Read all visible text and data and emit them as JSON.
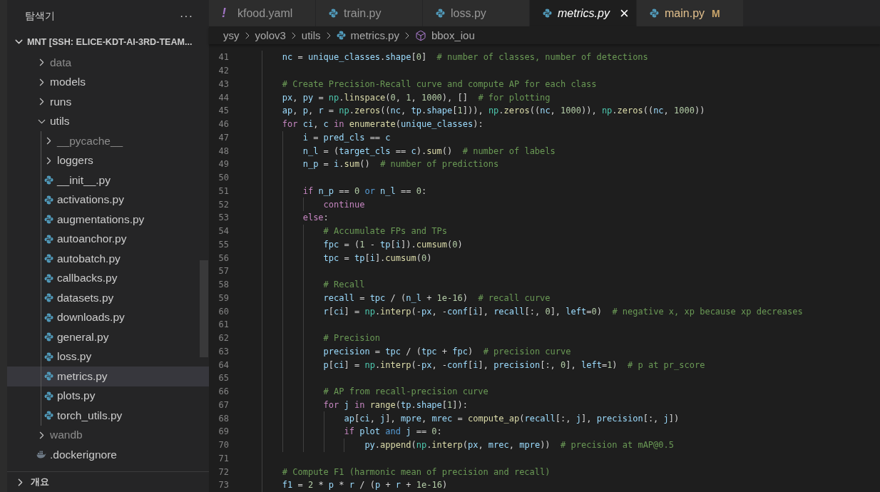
{
  "sidebar": {
    "title": "탐색기",
    "more": "···",
    "section": {
      "label": "MNT [SSH: ELICE-KDT-AI-3RD-TEAM...",
      "expanded": true
    },
    "tree": [
      {
        "label": "data",
        "kind": "folder",
        "expanded": false,
        "dimmed": true,
        "selected": false
      },
      {
        "label": "models",
        "kind": "folder",
        "expanded": false,
        "dimmed": false,
        "selected": false
      },
      {
        "label": "runs",
        "kind": "folder",
        "expanded": false,
        "dimmed": false,
        "selected": false
      },
      {
        "label": "utils",
        "kind": "folder",
        "expanded": true,
        "dimmed": false,
        "selected": false,
        "children": [
          {
            "label": "__pycache__",
            "kind": "folder",
            "expanded": false,
            "dimmed": true,
            "selected": false
          },
          {
            "label": "loggers",
            "kind": "folder",
            "expanded": false,
            "dimmed": false,
            "selected": false
          },
          {
            "label": "__init__.py",
            "kind": "python",
            "dimmed": false,
            "selected": false
          },
          {
            "label": "activations.py",
            "kind": "python",
            "dimmed": false,
            "selected": false
          },
          {
            "label": "augmentations.py",
            "kind": "python",
            "dimmed": false,
            "selected": false
          },
          {
            "label": "autoanchor.py",
            "kind": "python",
            "dimmed": false,
            "selected": false
          },
          {
            "label": "autobatch.py",
            "kind": "python",
            "dimmed": false,
            "selected": false
          },
          {
            "label": "callbacks.py",
            "kind": "python",
            "dimmed": false,
            "selected": false
          },
          {
            "label": "datasets.py",
            "kind": "python",
            "dimmed": false,
            "selected": false
          },
          {
            "label": "downloads.py",
            "kind": "python",
            "dimmed": false,
            "selected": false
          },
          {
            "label": "general.py",
            "kind": "python",
            "dimmed": false,
            "selected": false
          },
          {
            "label": "loss.py",
            "kind": "python",
            "dimmed": false,
            "selected": false
          },
          {
            "label": "metrics.py",
            "kind": "python",
            "dimmed": false,
            "selected": true
          },
          {
            "label": "plots.py",
            "kind": "python",
            "dimmed": false,
            "selected": false
          },
          {
            "label": "torch_utils.py",
            "kind": "python",
            "dimmed": false,
            "selected": false
          }
        ]
      },
      {
        "label": "wandb",
        "kind": "folder",
        "expanded": false,
        "dimmed": true,
        "selected": false
      },
      {
        "label": ".dockerignore",
        "kind": "docker",
        "dimmed": false,
        "selected": false
      }
    ],
    "outline": {
      "label": "개요",
      "expanded": false
    }
  },
  "tabs": [
    {
      "label": "kfood.yaml",
      "kind": "yaml",
      "icon_text": "!",
      "selected": false,
      "preview": false
    },
    {
      "label": "train.py",
      "kind": "python",
      "selected": false,
      "preview": false
    },
    {
      "label": "loss.py",
      "kind": "python",
      "selected": false,
      "preview": false
    },
    {
      "label": "metrics.py",
      "kind": "python",
      "selected": true,
      "preview": true,
      "close": "×"
    },
    {
      "label": "main.py",
      "kind": "python",
      "selected": false,
      "preview": false,
      "badge": "M"
    }
  ],
  "breadcrumb": [
    {
      "label": "ysy",
      "kind": "folder"
    },
    {
      "label": "yolov3",
      "kind": "folder"
    },
    {
      "label": "utils",
      "kind": "folder"
    },
    {
      "label": "metrics.py",
      "kind": "python"
    },
    {
      "label": "bbox_iou",
      "kind": "symbol"
    }
  ],
  "code": [
    {
      "number": "41",
      "tokens": [
        {
          "kind": "var",
          "text": "        nc"
        },
        {
          "kind": "pl",
          "text": " = "
        },
        {
          "kind": "var",
          "text": "unique_classes"
        },
        {
          "kind": "pl",
          "text": "."
        },
        {
          "kind": "var",
          "text": "shape"
        },
        {
          "kind": "pl",
          "text": "["
        },
        {
          "kind": "num",
          "text": "0"
        },
        {
          "kind": "pl",
          "text": "]  "
        },
        {
          "kind": "cmt",
          "text": "# number of classes, number of detections"
        }
      ]
    },
    {
      "number": "42"
    },
    {
      "number": "43",
      "tokens": [
        {
          "kind": "cmt",
          "text": "        # Create Precision-Recall curve and compute AP for each class"
        }
      ]
    },
    {
      "number": "44",
      "tokens": [
        {
          "kind": "var",
          "text": "        px"
        },
        {
          "kind": "pl",
          "text": ", "
        },
        {
          "kind": "var",
          "text": "py"
        },
        {
          "kind": "pl",
          "text": " = "
        },
        {
          "kind": "mod",
          "text": "np"
        },
        {
          "kind": "pl",
          "text": "."
        },
        {
          "kind": "fn",
          "text": "linspace"
        },
        {
          "kind": "pl",
          "text": "("
        },
        {
          "kind": "num",
          "text": "0"
        },
        {
          "kind": "pl",
          "text": ", "
        },
        {
          "kind": "num",
          "text": "1"
        },
        {
          "kind": "pl",
          "text": ", "
        },
        {
          "kind": "num",
          "text": "1000"
        },
        {
          "kind": "pl",
          "text": "), []  "
        },
        {
          "kind": "cmt",
          "text": "# for plotting"
        }
      ]
    },
    {
      "number": "45",
      "tokens": [
        {
          "kind": "var",
          "text": "        ap"
        },
        {
          "kind": "pl",
          "text": ", "
        },
        {
          "kind": "var",
          "text": "p"
        },
        {
          "kind": "pl",
          "text": ", "
        },
        {
          "kind": "var",
          "text": "r"
        },
        {
          "kind": "pl",
          "text": " = "
        },
        {
          "kind": "mod",
          "text": "np"
        },
        {
          "kind": "pl",
          "text": "."
        },
        {
          "kind": "fn",
          "text": "zeros"
        },
        {
          "kind": "pl",
          "text": "(("
        },
        {
          "kind": "var",
          "text": "nc"
        },
        {
          "kind": "pl",
          "text": ", "
        },
        {
          "kind": "var",
          "text": "tp"
        },
        {
          "kind": "pl",
          "text": "."
        },
        {
          "kind": "var",
          "text": "shape"
        },
        {
          "kind": "pl",
          "text": "["
        },
        {
          "kind": "num",
          "text": "1"
        },
        {
          "kind": "pl",
          "text": "])), "
        },
        {
          "kind": "mod",
          "text": "np"
        },
        {
          "kind": "pl",
          "text": "."
        },
        {
          "kind": "fn",
          "text": "zeros"
        },
        {
          "kind": "pl",
          "text": "(("
        },
        {
          "kind": "var",
          "text": "nc"
        },
        {
          "kind": "pl",
          "text": ", "
        },
        {
          "kind": "num",
          "text": "1000"
        },
        {
          "kind": "pl",
          "text": ")), "
        },
        {
          "kind": "mod",
          "text": "np"
        },
        {
          "kind": "pl",
          "text": "."
        },
        {
          "kind": "fn",
          "text": "zeros"
        },
        {
          "kind": "pl",
          "text": "(("
        },
        {
          "kind": "var",
          "text": "nc"
        },
        {
          "kind": "pl",
          "text": ", "
        },
        {
          "kind": "num",
          "text": "1000"
        },
        {
          "kind": "pl",
          "text": "))"
        }
      ]
    },
    {
      "number": "46",
      "tokens": [
        {
          "kind": "ctl",
          "text": "        for "
        },
        {
          "kind": "var",
          "text": "ci"
        },
        {
          "kind": "pl",
          "text": ", "
        },
        {
          "kind": "var",
          "text": "c "
        },
        {
          "kind": "ctl",
          "text": "in "
        },
        {
          "kind": "fn",
          "text": "enumerate"
        },
        {
          "kind": "pl",
          "text": "("
        },
        {
          "kind": "var",
          "text": "unique_classes"
        },
        {
          "kind": "pl",
          "text": "):"
        }
      ]
    },
    {
      "number": "47",
      "tokens": [
        {
          "kind": "var",
          "text": "            i"
        },
        {
          "kind": "pl",
          "text": " = "
        },
        {
          "kind": "var",
          "text": "pred_cls"
        },
        {
          "kind": "pl",
          "text": " == "
        },
        {
          "kind": "var",
          "text": "c"
        }
      ]
    },
    {
      "number": "48",
      "tokens": [
        {
          "kind": "var",
          "text": "            n_l"
        },
        {
          "kind": "pl",
          "text": " = ("
        },
        {
          "kind": "var",
          "text": "target_cls"
        },
        {
          "kind": "pl",
          "text": " == "
        },
        {
          "kind": "var",
          "text": "c"
        },
        {
          "kind": "pl",
          "text": ")."
        },
        {
          "kind": "fn",
          "text": "sum"
        },
        {
          "kind": "pl",
          "text": "()  "
        },
        {
          "kind": "cmt",
          "text": "# number of labels"
        }
      ]
    },
    {
      "number": "49",
      "tokens": [
        {
          "kind": "var",
          "text": "            n_p"
        },
        {
          "kind": "pl",
          "text": " = "
        },
        {
          "kind": "var",
          "text": "i"
        },
        {
          "kind": "pl",
          "text": "."
        },
        {
          "kind": "fn",
          "text": "sum"
        },
        {
          "kind": "pl",
          "text": "()  "
        },
        {
          "kind": "cmt",
          "text": "# number of predictions"
        }
      ]
    },
    {
      "number": "50"
    },
    {
      "number": "51",
      "tokens": [
        {
          "kind": "ctl",
          "text": "            if "
        },
        {
          "kind": "var",
          "text": "n_p"
        },
        {
          "kind": "pl",
          "text": " == "
        },
        {
          "kind": "num",
          "text": "0 "
        },
        {
          "kind": "kw",
          "text": "or "
        },
        {
          "kind": "var",
          "text": "n_l"
        },
        {
          "kind": "pl",
          "text": " == "
        },
        {
          "kind": "num",
          "text": "0"
        },
        {
          "kind": "pl",
          "text": ":"
        }
      ]
    },
    {
      "number": "52",
      "tokens": [
        {
          "kind": "ctl",
          "text": "                continue"
        }
      ]
    },
    {
      "number": "53",
      "tokens": [
        {
          "kind": "ctl",
          "text": "            else"
        },
        {
          "kind": "pl",
          "text": ":"
        }
      ]
    },
    {
      "number": "54",
      "tokens": [
        {
          "kind": "cmt",
          "text": "                # Accumulate FPs and TPs"
        }
      ]
    },
    {
      "number": "55",
      "tokens": [
        {
          "kind": "var",
          "text": "                fpc"
        },
        {
          "kind": "pl",
          "text": " = ("
        },
        {
          "kind": "num",
          "text": "1"
        },
        {
          "kind": "pl",
          "text": " - "
        },
        {
          "kind": "var",
          "text": "tp"
        },
        {
          "kind": "pl",
          "text": "["
        },
        {
          "kind": "var",
          "text": "i"
        },
        {
          "kind": "pl",
          "text": "])."
        },
        {
          "kind": "fn",
          "text": "cumsum"
        },
        {
          "kind": "pl",
          "text": "("
        },
        {
          "kind": "num",
          "text": "0"
        },
        {
          "kind": "pl",
          "text": ")"
        }
      ]
    },
    {
      "number": "56",
      "tokens": [
        {
          "kind": "var",
          "text": "                tpc"
        },
        {
          "kind": "pl",
          "text": " = "
        },
        {
          "kind": "var",
          "text": "tp"
        },
        {
          "kind": "pl",
          "text": "["
        },
        {
          "kind": "var",
          "text": "i"
        },
        {
          "kind": "pl",
          "text": "]."
        },
        {
          "kind": "fn",
          "text": "cumsum"
        },
        {
          "kind": "pl",
          "text": "("
        },
        {
          "kind": "num",
          "text": "0"
        },
        {
          "kind": "pl",
          "text": ")"
        }
      ]
    },
    {
      "number": "57"
    },
    {
      "number": "58",
      "tokens": [
        {
          "kind": "cmt",
          "text": "                # Recall"
        }
      ]
    },
    {
      "number": "59",
      "tokens": [
        {
          "kind": "var",
          "text": "                recall"
        },
        {
          "kind": "pl",
          "text": " = "
        },
        {
          "kind": "var",
          "text": "tpc"
        },
        {
          "kind": "pl",
          "text": " / ("
        },
        {
          "kind": "var",
          "text": "n_l"
        },
        {
          "kind": "pl",
          "text": " + "
        },
        {
          "kind": "num",
          "text": "1e-16"
        },
        {
          "kind": "pl",
          "text": ")  "
        },
        {
          "kind": "cmt",
          "text": "# recall curve"
        }
      ]
    },
    {
      "number": "60",
      "tokens": [
        {
          "kind": "var",
          "text": "                r"
        },
        {
          "kind": "pl",
          "text": "["
        },
        {
          "kind": "var",
          "text": "ci"
        },
        {
          "kind": "pl",
          "text": "] = "
        },
        {
          "kind": "mod",
          "text": "np"
        },
        {
          "kind": "pl",
          "text": "."
        },
        {
          "kind": "fn",
          "text": "interp"
        },
        {
          "kind": "pl",
          "text": "(-"
        },
        {
          "kind": "var",
          "text": "px"
        },
        {
          "kind": "pl",
          "text": ", -"
        },
        {
          "kind": "var",
          "text": "conf"
        },
        {
          "kind": "pl",
          "text": "["
        },
        {
          "kind": "var",
          "text": "i"
        },
        {
          "kind": "pl",
          "text": "], "
        },
        {
          "kind": "var",
          "text": "recall"
        },
        {
          "kind": "pl",
          "text": "[:, "
        },
        {
          "kind": "num",
          "text": "0"
        },
        {
          "kind": "pl",
          "text": "], "
        },
        {
          "kind": "var",
          "text": "left"
        },
        {
          "kind": "pl",
          "text": "="
        },
        {
          "kind": "num",
          "text": "0"
        },
        {
          "kind": "pl",
          "text": ")  "
        },
        {
          "kind": "cmt",
          "text": "# negative x, xp because xp decreases"
        }
      ]
    },
    {
      "number": "61"
    },
    {
      "number": "62",
      "tokens": [
        {
          "kind": "cmt",
          "text": "                # Precision"
        }
      ]
    },
    {
      "number": "63",
      "tokens": [
        {
          "kind": "var",
          "text": "                precision"
        },
        {
          "kind": "pl",
          "text": " = "
        },
        {
          "kind": "var",
          "text": "tpc"
        },
        {
          "kind": "pl",
          "text": " / ("
        },
        {
          "kind": "var",
          "text": "tpc"
        },
        {
          "kind": "pl",
          "text": " + "
        },
        {
          "kind": "var",
          "text": "fpc"
        },
        {
          "kind": "pl",
          "text": ")  "
        },
        {
          "kind": "cmt",
          "text": "# precision curve"
        }
      ]
    },
    {
      "number": "64",
      "tokens": [
        {
          "kind": "var",
          "text": "                p"
        },
        {
          "kind": "pl",
          "text": "["
        },
        {
          "kind": "var",
          "text": "ci"
        },
        {
          "kind": "pl",
          "text": "] = "
        },
        {
          "kind": "mod",
          "text": "np"
        },
        {
          "kind": "pl",
          "text": "."
        },
        {
          "kind": "fn",
          "text": "interp"
        },
        {
          "kind": "pl",
          "text": "(-"
        },
        {
          "kind": "var",
          "text": "px"
        },
        {
          "kind": "pl",
          "text": ", -"
        },
        {
          "kind": "var",
          "text": "conf"
        },
        {
          "kind": "pl",
          "text": "["
        },
        {
          "kind": "var",
          "text": "i"
        },
        {
          "kind": "pl",
          "text": "], "
        },
        {
          "kind": "var",
          "text": "precision"
        },
        {
          "kind": "pl",
          "text": "[:, "
        },
        {
          "kind": "num",
          "text": "0"
        },
        {
          "kind": "pl",
          "text": "], "
        },
        {
          "kind": "var",
          "text": "left"
        },
        {
          "kind": "pl",
          "text": "="
        },
        {
          "kind": "num",
          "text": "1"
        },
        {
          "kind": "pl",
          "text": ")  "
        },
        {
          "kind": "cmt",
          "text": "# p at pr_score"
        }
      ]
    },
    {
      "number": "65"
    },
    {
      "number": "66",
      "tokens": [
        {
          "kind": "cmt",
          "text": "                # AP from recall-precision curve"
        }
      ]
    },
    {
      "number": "67",
      "tokens": [
        {
          "kind": "ctl",
          "text": "                for "
        },
        {
          "kind": "var",
          "text": "j "
        },
        {
          "kind": "ctl",
          "text": "in "
        },
        {
          "kind": "fn",
          "text": "range"
        },
        {
          "kind": "pl",
          "text": "("
        },
        {
          "kind": "var",
          "text": "tp"
        },
        {
          "kind": "pl",
          "text": "."
        },
        {
          "kind": "var",
          "text": "shape"
        },
        {
          "kind": "pl",
          "text": "["
        },
        {
          "kind": "num",
          "text": "1"
        },
        {
          "kind": "pl",
          "text": "]):"
        }
      ]
    },
    {
      "number": "68",
      "tokens": [
        {
          "kind": "var",
          "text": "                    ap"
        },
        {
          "kind": "pl",
          "text": "["
        },
        {
          "kind": "var",
          "text": "ci"
        },
        {
          "kind": "pl",
          "text": ", "
        },
        {
          "kind": "var",
          "text": "j"
        },
        {
          "kind": "pl",
          "text": "], "
        },
        {
          "kind": "var",
          "text": "mpre"
        },
        {
          "kind": "pl",
          "text": ", "
        },
        {
          "kind": "var",
          "text": "mrec"
        },
        {
          "kind": "pl",
          "text": " = "
        },
        {
          "kind": "fn",
          "text": "compute_ap"
        },
        {
          "kind": "pl",
          "text": "("
        },
        {
          "kind": "var",
          "text": "recall"
        },
        {
          "kind": "pl",
          "text": "[:, "
        },
        {
          "kind": "var",
          "text": "j"
        },
        {
          "kind": "pl",
          "text": "], "
        },
        {
          "kind": "var",
          "text": "precision"
        },
        {
          "kind": "pl",
          "text": "[:, "
        },
        {
          "kind": "var",
          "text": "j"
        },
        {
          "kind": "pl",
          "text": "])"
        }
      ]
    },
    {
      "number": "69",
      "tokens": [
        {
          "kind": "ctl",
          "text": "                    if "
        },
        {
          "kind": "var",
          "text": "plot "
        },
        {
          "kind": "kw",
          "text": "and "
        },
        {
          "kind": "var",
          "text": "j"
        },
        {
          "kind": "pl",
          "text": " == "
        },
        {
          "kind": "num",
          "text": "0"
        },
        {
          "kind": "pl",
          "text": ":"
        }
      ]
    },
    {
      "number": "70",
      "tokens": [
        {
          "kind": "var",
          "text": "                        py"
        },
        {
          "kind": "pl",
          "text": "."
        },
        {
          "kind": "fn",
          "text": "append"
        },
        {
          "kind": "pl",
          "text": "("
        },
        {
          "kind": "mod",
          "text": "np"
        },
        {
          "kind": "pl",
          "text": "."
        },
        {
          "kind": "fn",
          "text": "interp"
        },
        {
          "kind": "pl",
          "text": "("
        },
        {
          "kind": "var",
          "text": "px"
        },
        {
          "kind": "pl",
          "text": ", "
        },
        {
          "kind": "var",
          "text": "mrec"
        },
        {
          "kind": "pl",
          "text": ", "
        },
        {
          "kind": "var",
          "text": "mpre"
        },
        {
          "kind": "pl",
          "text": "))  "
        },
        {
          "kind": "cmt",
          "text": "# precision at mAP@0.5"
        }
      ]
    },
    {
      "number": "71"
    },
    {
      "number": "72",
      "tokens": [
        {
          "kind": "cmt",
          "text": "        # Compute F1 (harmonic mean of precision and recall)"
        }
      ]
    },
    {
      "number": "73",
      "tokens": [
        {
          "kind": "var",
          "text": "        f1"
        },
        {
          "kind": "pl",
          "text": " = "
        },
        {
          "kind": "num",
          "text": "2"
        },
        {
          "kind": "pl",
          "text": " * "
        },
        {
          "kind": "var",
          "text": "p"
        },
        {
          "kind": "pl",
          "text": " * "
        },
        {
          "kind": "var",
          "text": "r"
        },
        {
          "kind": "pl",
          "text": " / ("
        },
        {
          "kind": "var",
          "text": "p"
        },
        {
          "kind": "pl",
          "text": " + "
        },
        {
          "kind": "var",
          "text": "r"
        },
        {
          "kind": "pl",
          "text": " + "
        },
        {
          "kind": "num",
          "text": "1e-16"
        },
        {
          "kind": "pl",
          "text": ")"
        }
      ]
    }
  ]
}
